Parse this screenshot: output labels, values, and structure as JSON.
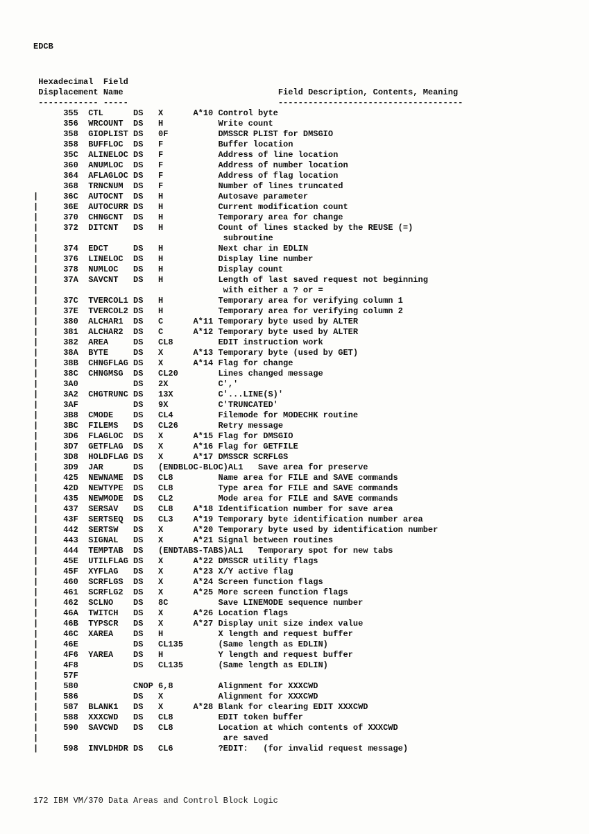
{
  "page_label": "EDCB",
  "headers": {
    "col1_line1": "Hexadecimal",
    "col1_line2": "Displacement",
    "col2_line1": "Field",
    "col2_line2": "Name",
    "col3_line2": "Field Description, Contents, Meaning"
  },
  "rows": [
    {
      "bar": "",
      "disp": "355",
      "name": "CTL",
      "op": "DS",
      "type": "X",
      "note": "A*10",
      "desc": "Control byte"
    },
    {
      "bar": "",
      "disp": "356",
      "name": "WRCOUNT",
      "op": "DS",
      "type": "H",
      "note": "",
      "desc": "Write count"
    },
    {
      "bar": "",
      "disp": "358",
      "name": "GIOPLIST",
      "op": "DS",
      "type": "0F",
      "note": "",
      "desc": "DMSSCR PLIST for DMSGIO"
    },
    {
      "bar": "",
      "disp": "358",
      "name": "BUFFLOC",
      "op": "DS",
      "type": "F",
      "note": "",
      "desc": "Buffer location"
    },
    {
      "bar": "",
      "disp": "35C",
      "name": "ALINELOC",
      "op": "DS",
      "type": "F",
      "note": "",
      "desc": "Address of line location"
    },
    {
      "bar": "",
      "disp": "360",
      "name": "ANUMLOC",
      "op": "DS",
      "type": "F",
      "note": "",
      "desc": "Address of number location"
    },
    {
      "bar": "",
      "disp": "364",
      "name": "AFLAGLOC",
      "op": "DS",
      "type": "F",
      "note": "",
      "desc": "Address of flag location"
    },
    {
      "bar": "",
      "disp": "368",
      "name": "TRNCNUM",
      "op": "DS",
      "type": "F",
      "note": "",
      "desc": "Number of lines truncated"
    },
    {
      "bar": "|",
      "disp": "36C",
      "name": "AUTOCNT",
      "op": "DS",
      "type": "H",
      "note": "",
      "desc": "Autosave parameter"
    },
    {
      "bar": "|",
      "disp": "36E",
      "name": "AUTOCURR",
      "op": "DS",
      "type": "H",
      "note": "",
      "desc": "Current modification count"
    },
    {
      "bar": "|",
      "disp": "370",
      "name": "CHNGCNT",
      "op": "DS",
      "type": "H",
      "note": "",
      "desc": "Temporary area for change"
    },
    {
      "bar": "|",
      "disp": "372",
      "name": "DITCNT",
      "op": "DS",
      "type": "H",
      "note": "",
      "desc": "Count of lines stacked by the REUSE (=)"
    },
    {
      "bar": "|",
      "disp": "",
      "name": "",
      "op": "",
      "type": "",
      "note": "",
      "desc": " subroutine"
    },
    {
      "bar": "|",
      "disp": "374",
      "name": "EDCT",
      "op": "DS",
      "type": "H",
      "note": "",
      "desc": "Next char in EDLIN"
    },
    {
      "bar": "|",
      "disp": "376",
      "name": "LINELOC",
      "op": "DS",
      "type": "H",
      "note": "",
      "desc": "Display line number"
    },
    {
      "bar": "|",
      "disp": "378",
      "name": "NUMLOC",
      "op": "DS",
      "type": "H",
      "note": "",
      "desc": "Display count"
    },
    {
      "bar": "|",
      "disp": "37A",
      "name": "SAVCNT",
      "op": "DS",
      "type": "H",
      "note": "",
      "desc": "Length of last saved request not beginning"
    },
    {
      "bar": "|",
      "disp": "",
      "name": "",
      "op": "",
      "type": "",
      "note": "",
      "desc": " with either a ? or ="
    },
    {
      "bar": "|",
      "disp": "37C",
      "name": "TVERCOL1",
      "op": "DS",
      "type": "H",
      "note": "",
      "desc": "Temporary area for verifying column 1"
    },
    {
      "bar": "|",
      "disp": "37E",
      "name": "TVERCOL2",
      "op": "DS",
      "type": "H",
      "note": "",
      "desc": "Temporary area for verifying column 2"
    },
    {
      "bar": "|",
      "disp": "380",
      "name": "ALCHAR1",
      "op": "DS",
      "type": "C",
      "note": "A*11",
      "desc": "Temporary byte used by ALTER"
    },
    {
      "bar": "|",
      "disp": "381",
      "name": "ALCHAR2",
      "op": "DS",
      "type": "C",
      "note": "A*12",
      "desc": "Temporary byte used by ALTER"
    },
    {
      "bar": "|",
      "disp": "382",
      "name": "AREA",
      "op": "DS",
      "type": "CL8",
      "note": "",
      "desc": "EDIT instruction work"
    },
    {
      "bar": "|",
      "disp": "38A",
      "name": "BYTE",
      "op": "DS",
      "type": "X",
      "note": "A*13",
      "desc": "Temporary byte (used by GET)"
    },
    {
      "bar": "|",
      "disp": "38B",
      "name": "CHNGFLAG",
      "op": "DS",
      "type": "X",
      "note": "A*14",
      "desc": "Flag for change"
    },
    {
      "bar": "|",
      "disp": "38C",
      "name": "CHNGMSG",
      "op": "DS",
      "type": "CL20",
      "note": "",
      "desc": "Lines changed message"
    },
    {
      "bar": "|",
      "disp": "3A0",
      "name": "",
      "op": "DS",
      "type": "2X",
      "note": "",
      "desc": "C','"
    },
    {
      "bar": "|",
      "disp": "3A2",
      "name": "CHGTRUNC",
      "op": "DS",
      "type": "13X",
      "note": "",
      "desc": "C'...LINE(S)'"
    },
    {
      "bar": "|",
      "disp": "3AF",
      "name": "",
      "op": "DS",
      "type": "9X",
      "note": "",
      "desc": "C'TRUNCATED'"
    },
    {
      "bar": "|",
      "disp": "3B8",
      "name": "CMODE",
      "op": "DS",
      "type": "CL4",
      "note": "",
      "desc": "Filemode for MODECHK routine"
    },
    {
      "bar": "|",
      "disp": "3BC",
      "name": "FILEMS",
      "op": "DS",
      "type": "CL26",
      "note": "",
      "desc": "Retry message"
    },
    {
      "bar": "|",
      "disp": "3D6",
      "name": "FLAGLOC",
      "op": "DS",
      "type": "X",
      "note": "A*15",
      "desc": "Flag for DMSGIO"
    },
    {
      "bar": "|",
      "disp": "3D7",
      "name": "GETFLAG",
      "op": "DS",
      "type": "X",
      "note": "A*16",
      "desc": "Flag for GETFILE"
    },
    {
      "bar": "|",
      "disp": "3D8",
      "name": "HOLDFLAG",
      "op": "DS",
      "type": "X",
      "note": "A*17",
      "desc": "DMSSCR SCRFLGS"
    },
    {
      "bar": "|",
      "disp": "3D9",
      "name": "JAR",
      "op": "DS",
      "type": "(ENDBLOC-BLOC)AL1",
      "note": "",
      "desc": "Save area for preserve",
      "raw": true
    },
    {
      "bar": "|",
      "disp": "425",
      "name": "NEWNAME",
      "op": "DS",
      "type": "CL8",
      "note": "",
      "desc": "Name area for FILE and SAVE commands"
    },
    {
      "bar": "|",
      "disp": "42D",
      "name": "NEWTYPE",
      "op": "DS",
      "type": "CL8",
      "note": "",
      "desc": "Type area for FILE and SAVE commands"
    },
    {
      "bar": "|",
      "disp": "435",
      "name": "NEWMODE",
      "op": "DS",
      "type": "CL2",
      "note": "",
      "desc": "Mode area for FILE and SAVE commands"
    },
    {
      "bar": "|",
      "disp": "437",
      "name": "SERSAV",
      "op": "DS",
      "type": "CL8",
      "note": "A*18",
      "desc": "Identification number for save area"
    },
    {
      "bar": "|",
      "disp": "43F",
      "name": "SERTSEQ",
      "op": "DS",
      "type": "CL3",
      "note": "A*19",
      "desc": "Temporary byte identification number area"
    },
    {
      "bar": "|",
      "disp": "442",
      "name": "SERTSW",
      "op": "DS",
      "type": "X",
      "note": "A*20",
      "desc": "Temporary byte used by identification number"
    },
    {
      "bar": "|",
      "disp": "443",
      "name": "SIGNAL",
      "op": "DS",
      "type": "X",
      "note": "A*21",
      "desc": "Signal between routines"
    },
    {
      "bar": "|",
      "disp": "444",
      "name": "TEMPTAB",
      "op": "DS",
      "type": "(ENDTABS-TABS)AL1",
      "note": "",
      "desc": "Temporary spot for new tabs",
      "raw": true
    },
    {
      "bar": "|",
      "disp": "45E",
      "name": "UTILFLAG",
      "op": "DS",
      "type": "X",
      "note": "A*22",
      "desc": "DMSSCR utility flags"
    },
    {
      "bar": "|",
      "disp": "45F",
      "name": "XYFLAG",
      "op": "DS",
      "type": "X",
      "note": "A*23",
      "desc": "X/Y active flag"
    },
    {
      "bar": "|",
      "disp": "460",
      "name": "SCRFLGS",
      "op": "DS",
      "type": "X",
      "note": "A*24",
      "desc": "Screen function flags"
    },
    {
      "bar": "|",
      "disp": "461",
      "name": "SCRFLG2",
      "op": "DS",
      "type": "X",
      "note": "A*25",
      "desc": "More screen function flags"
    },
    {
      "bar": "|",
      "disp": "462",
      "name": "SCLNO",
      "op": "DS",
      "type": "8C",
      "note": "",
      "desc": "Save LINEMODE sequence number"
    },
    {
      "bar": "|",
      "disp": "46A",
      "name": "TWITCH",
      "op": "DS",
      "type": "X",
      "note": "A*26",
      "desc": "Location flags"
    },
    {
      "bar": "|",
      "disp": "46B",
      "name": "TYPSCR",
      "op": "DS",
      "type": "X",
      "note": "A*27",
      "desc": "Display unit size index value"
    },
    {
      "bar": "|",
      "disp": "46C",
      "name": "XAREA",
      "op": "DS",
      "type": "H",
      "note": "",
      "desc": "X length and request buffer"
    },
    {
      "bar": "|",
      "disp": "46E",
      "name": "",
      "op": "DS",
      "type": "CL135",
      "note": "",
      "desc": "(Same length as EDLIN)"
    },
    {
      "bar": "|",
      "disp": "4F6",
      "name": "YAREA",
      "op": "DS",
      "type": "H",
      "note": "",
      "desc": "Y length and request buffer"
    },
    {
      "bar": "|",
      "disp": "4F8",
      "name": "",
      "op": "DS",
      "type": "CL135",
      "note": "",
      "desc": "(Same length as EDLIN)"
    },
    {
      "bar": "|",
      "disp": "57F",
      "name": "",
      "op": "",
      "type": "",
      "note": "",
      "desc": ""
    },
    {
      "bar": "|",
      "disp": "580",
      "name": "",
      "op": "CNOP",
      "type": "6,8",
      "note": "",
      "desc": "Alignment for XXXCWD"
    },
    {
      "bar": "|",
      "disp": "586",
      "name": "",
      "op": "DS",
      "type": "X",
      "note": "",
      "desc": "Alignment for XXXCWD"
    },
    {
      "bar": "|",
      "disp": "587",
      "name": "BLANK1",
      "op": "DS",
      "type": "X",
      "note": "A*28",
      "desc": "Blank for clearing EDIT XXXCWD"
    },
    {
      "bar": "|",
      "disp": "588",
      "name": "XXXCWD",
      "op": "DS",
      "type": "CL8",
      "note": "",
      "desc": "EDIT token buffer"
    },
    {
      "bar": "|",
      "disp": "590",
      "name": "SAVCWD",
      "op": "DS",
      "type": "CL8",
      "note": "",
      "desc": "Location at which contents of XXXCWD"
    },
    {
      "bar": "|",
      "disp": "",
      "name": "",
      "op": "",
      "type": "",
      "note": "",
      "desc": " are saved"
    },
    {
      "bar": "|",
      "disp": "598",
      "name": "INVLDHDR",
      "op": "DS",
      "type": "CL6",
      "note": "",
      "desc": "?EDIT:   (for invalid request message)"
    }
  ],
  "footer": "172  IBM VM/370 Data Areas and Control Block Logic"
}
